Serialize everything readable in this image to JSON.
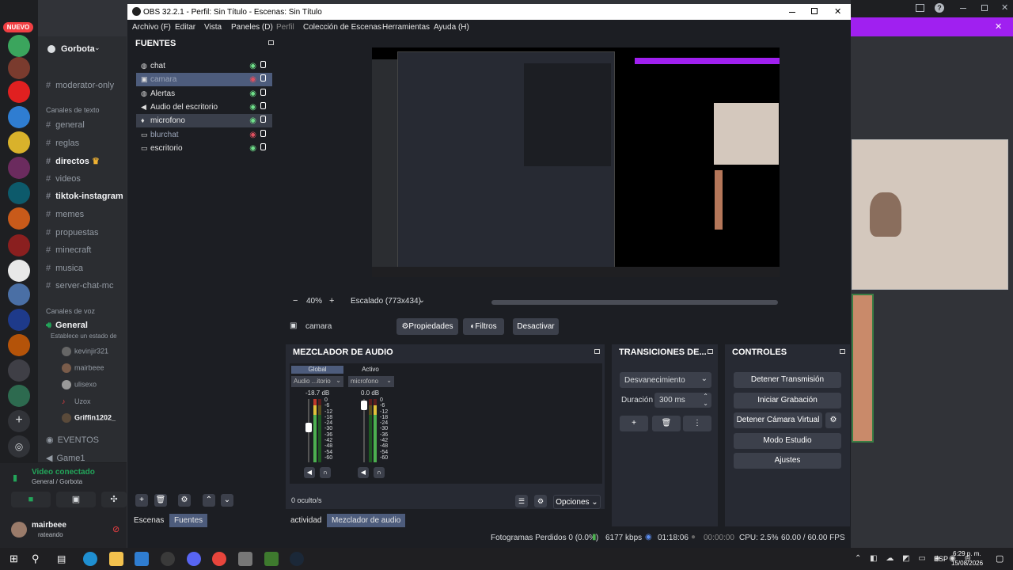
{
  "discord": {
    "nuevo_badge": "NUEVO",
    "server_name": "Gorbota",
    "channels_top": [
      {
        "name": "moderator-only",
        "bold": false
      }
    ],
    "text_category": "Canales de texto",
    "text_channels": [
      {
        "name": "general",
        "bold": false
      },
      {
        "name": "reglas",
        "bold": false
      },
      {
        "name": "directos",
        "bold": true
      },
      {
        "name": "videos",
        "bold": false
      },
      {
        "name": "tiktok-instagram",
        "bold": true
      },
      {
        "name": "memes",
        "bold": false
      },
      {
        "name": "propuestas",
        "bold": false
      },
      {
        "name": "minecraft",
        "bold": false
      },
      {
        "name": "musica",
        "bold": false
      },
      {
        "name": "server-chat-mc",
        "bold": false
      }
    ],
    "voice_category": "Canales de voz",
    "voice_channel": "General",
    "voice_status": "Establece un estado de ",
    "voice_members": [
      "kevinjir321",
      "mairbeee",
      "ulisexo",
      "Uzox",
      "Griffin1202_"
    ],
    "events_label": "EVENTOS",
    "game_label": "Game1",
    "video_connected": "Video conectado",
    "video_connected_sub": "General / Gorbota",
    "user_name": "mairbeee",
    "user_status": "rateando"
  },
  "obs": {
    "title": "OBS 32.2.1 - Perfil: Sin Título - Escenas: Sin Título",
    "menu": [
      "Archivo (F)",
      "Editar",
      "Vista",
      "Paneles (D)",
      "Perfil",
      "Colección de Escenas",
      "Herramientas",
      "Ayuda (H)"
    ],
    "sources_title": "FUENTES",
    "sources": [
      {
        "name": "chat",
        "icon": "globe-icon",
        "visible": true,
        "selected": false
      },
      {
        "name": "camara",
        "icon": "camera-icon",
        "visible": false,
        "selected": true
      },
      {
        "name": "Alertas",
        "icon": "globe-icon",
        "visible": true,
        "selected": false
      },
      {
        "name": "Audio del escritorio",
        "icon": "speaker-icon",
        "visible": true,
        "selected": false
      },
      {
        "name": "microfono",
        "icon": "mic-icon",
        "visible": true,
        "selected": true
      },
      {
        "name": "blurchat",
        "icon": "monitor-icon",
        "visible": false,
        "selected": false
      },
      {
        "name": "escritorio",
        "icon": "monitor-icon",
        "visible": true,
        "selected": false
      }
    ],
    "zoom_value": "40%",
    "scale_select": "Escalado (773x434)",
    "selected_source": "camara",
    "btn_properties": "Propiedades",
    "btn_filters": "Filtros",
    "btn_deactivate": "Desactivar",
    "tab_scenes": "Escenas",
    "tab_sources": "Fuentes",
    "mixer_title": "MEZCLADOR DE AUDIO",
    "mixer_channels": [
      {
        "name": "Global",
        "device": "Audio ...itorio",
        "db": "-18.7 dB",
        "level": 0.33
      },
      {
        "name": "Activo",
        "device": "microfono",
        "db": "0.0 dB",
        "level": 0.87
      }
    ],
    "meter_ticks": [
      "0",
      "-6",
      "-12",
      "-18",
      "-24",
      "-30",
      "-36",
      "-42",
      "-48",
      "-54",
      "-60"
    ],
    "hidden_count": "0 oculto/s",
    "options_label": "Opciones",
    "tab_activity": "actividad",
    "tab_mixer": "Mezclador de audio",
    "transitions_title": "TRANSICIONES DE...",
    "transition_select": "Desvanecimiento",
    "duration_label": "Duración",
    "duration_value": "300 ms",
    "controls_title": "CONTROLES",
    "controls": [
      "Detener Transmisión",
      "Iniciar Grabación",
      "Detener Cámara Virtual",
      "Modo Estudio",
      "Ajustes"
    ],
    "status": {
      "dropped": "Fotogramas Perdidos 0 (0.0%)",
      "bitrate": "6177 kbps",
      "stream_time": "01:18:06",
      "rec_time": "00:00:00",
      "cpu": "CPU: 2.5%",
      "fps": "60.00 / 60.00 FPS"
    }
  },
  "taskbar": {
    "lang": "ESP",
    "time": "6:29 p. m.",
    "date": "15/08/2026"
  },
  "colors": {
    "obs_bg": "#1c1e23",
    "obs_dock": "#272a33",
    "selection": "#4d5c7c",
    "discord_purple": "#a020f0",
    "meter_green": "#4caf50",
    "meter_yellow": "#e0c23a",
    "meter_red": "#c0392b"
  }
}
